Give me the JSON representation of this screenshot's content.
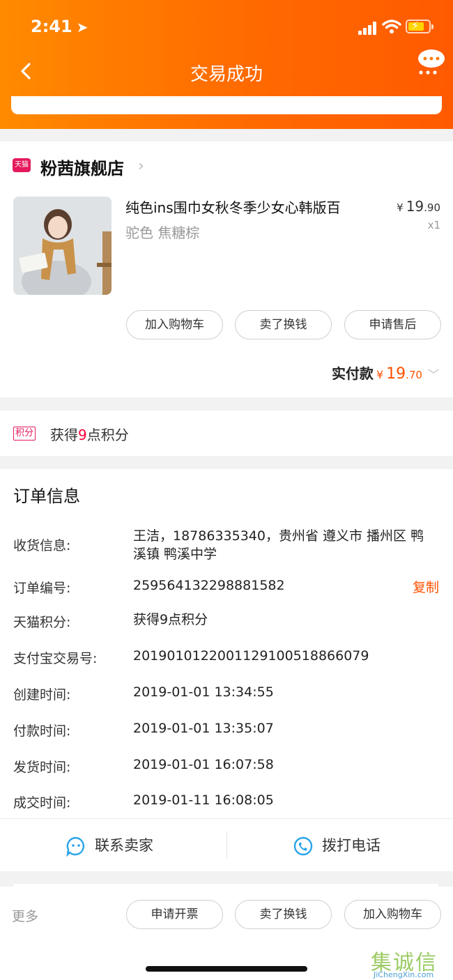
{
  "status_bar": {
    "time": "2:41"
  },
  "header": {
    "title": "交易成功"
  },
  "shop": {
    "badge": "天猫",
    "name": "粉茜旗舰店",
    "product": {
      "title": "纯色ins围巾女秋冬季少女心韩版百",
      "sku": "驼色 焦糖棕",
      "price_currency": "¥",
      "price_int": "19",
      "price_dec": ".90",
      "qty": "x1"
    },
    "actions": [
      "加入购物车",
      "卖了换钱",
      "申请售后"
    ],
    "paid": {
      "label": "实付款",
      "currency": "¥",
      "amount_int": "19",
      "amount_dec": ".70"
    }
  },
  "points": {
    "badge": "积分",
    "prefix": "获得",
    "num": "9",
    "suffix": "点积分"
  },
  "order": {
    "title": "订单信息",
    "rows": [
      {
        "label": "收货信息:",
        "value": "王洁，18786335340，贵州省 遵义市 播州区 鸭溪镇 鸭溪中学"
      },
      {
        "label": "订单编号:",
        "value": "259564132298881582"
      },
      {
        "label": "天猫积分:",
        "value": "获得9点积分"
      },
      {
        "label": "支付宝交易号:",
        "value": "2019010122001129100518866079"
      },
      {
        "label": "创建时间:",
        "value": "2019-01-01 13:34:55"
      },
      {
        "label": "付款时间:",
        "value": "2019-01-01 13:35:07"
      },
      {
        "label": "发货时间:",
        "value": "2019-01-01 16:07:58"
      },
      {
        "label": "成交时间:",
        "value": "2019-01-11 16:08:05"
      }
    ],
    "copy_label": "复制",
    "contact_seller": "联系卖家",
    "call_phone": "拨打电话"
  },
  "bottom": {
    "more": "更多",
    "actions": [
      "申请开票",
      "卖了换钱",
      "加入购物车"
    ]
  },
  "watermark": {
    "cn": "集诚信",
    "en": "JiChengXin.com"
  },
  "colors": {
    "accent": "#ff5000",
    "header": "#ff7a00",
    "tmall": "#e5195b",
    "icon_blue": "#2aa4e8"
  }
}
